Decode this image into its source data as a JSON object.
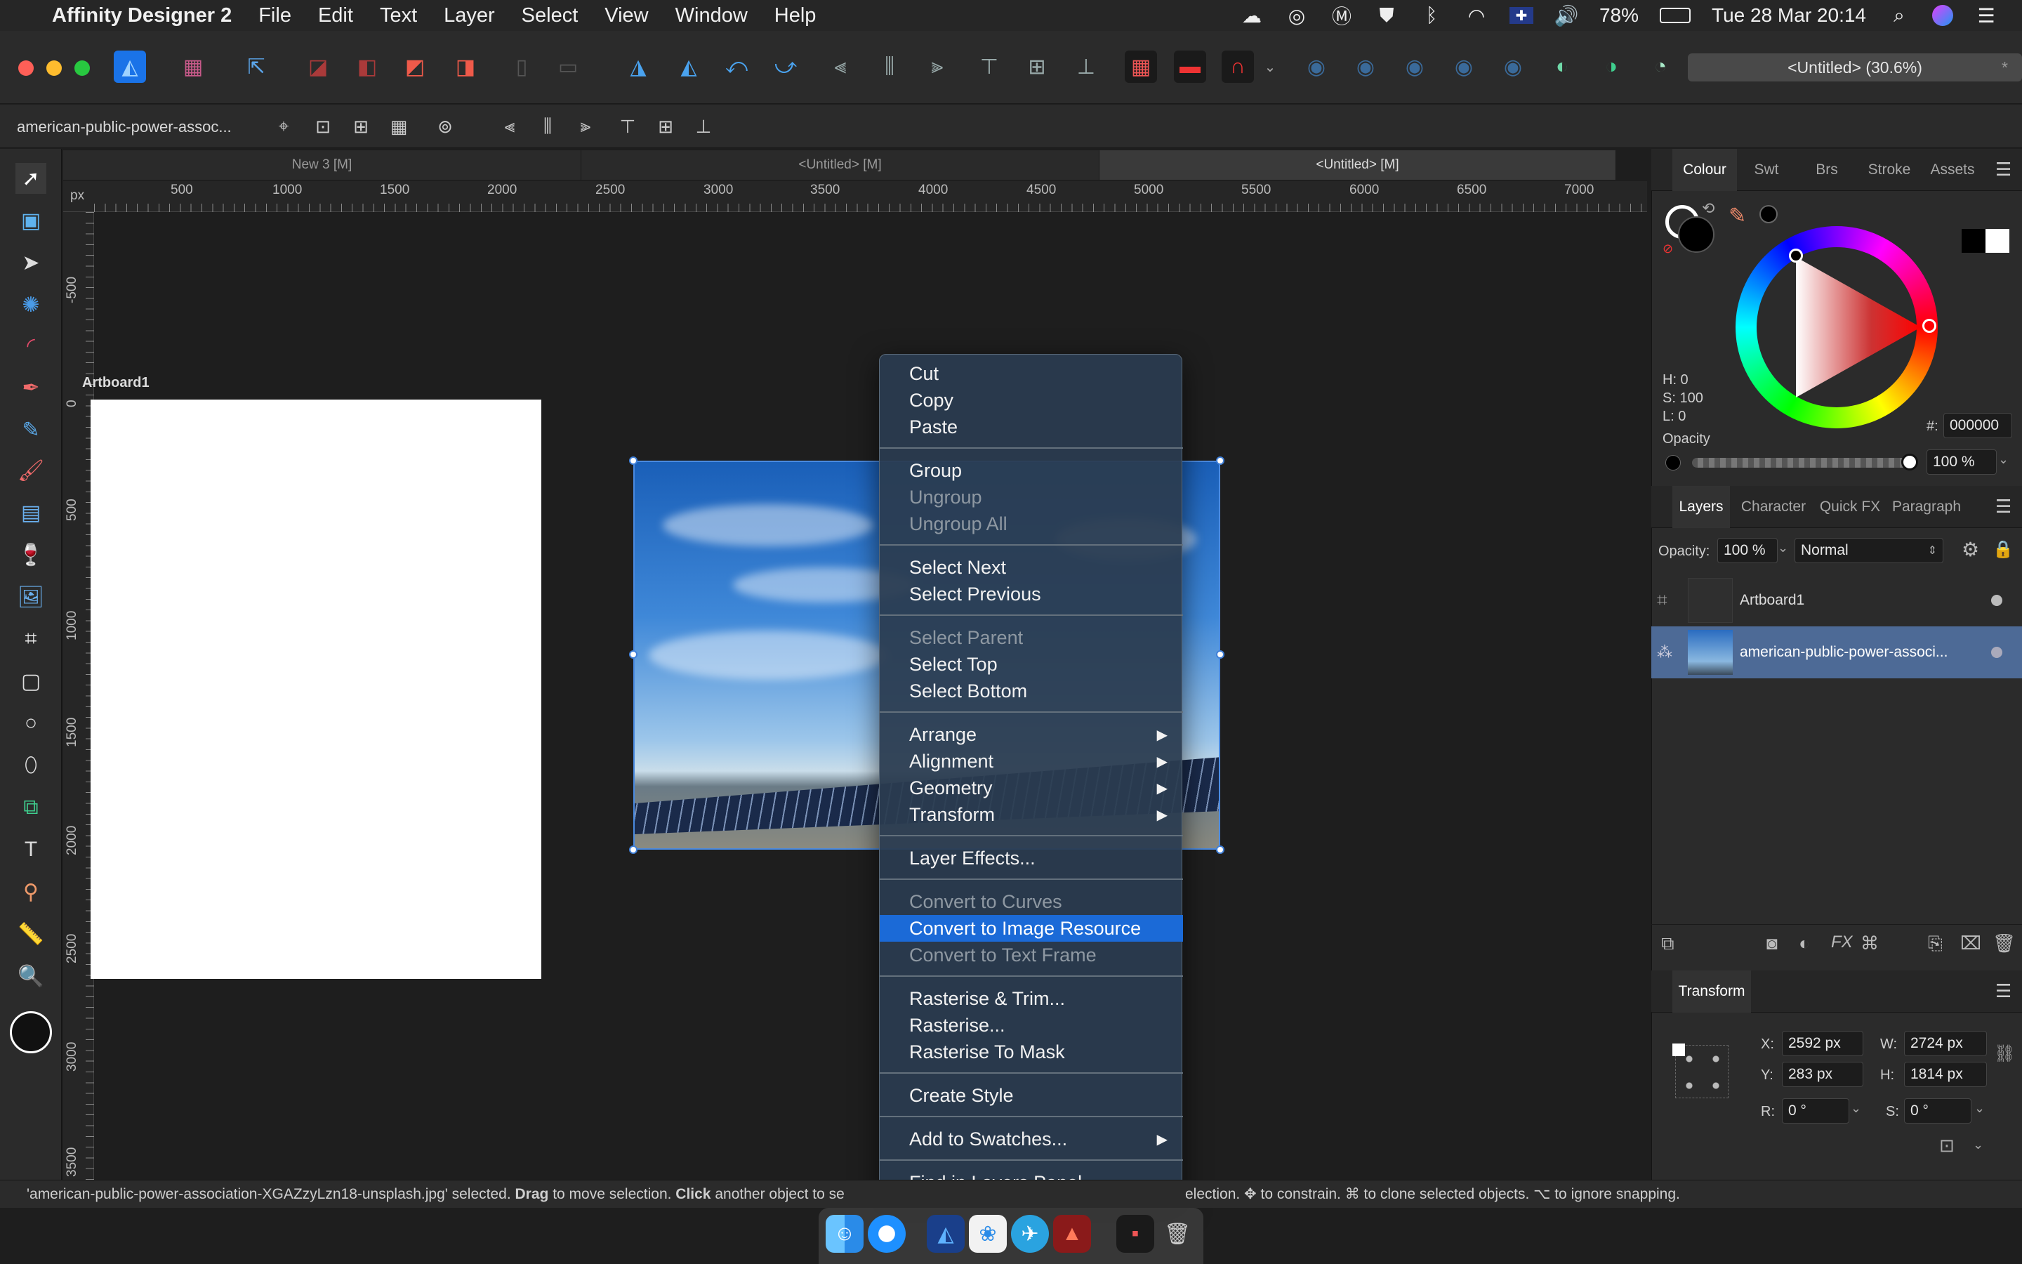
{
  "menubar": {
    "app": "Affinity Designer 2",
    "items": [
      "File",
      "Edit",
      "Text",
      "Layer",
      "Select",
      "View",
      "Window",
      "Help"
    ],
    "battery": "78%",
    "clock": "Tue 28 Mar  20:14"
  },
  "toolbar": {
    "document_title": "<Untitled> (30.6%)"
  },
  "context": {
    "selection_label": "american-public-power-assoc..."
  },
  "doc_tabs": [
    "New 3 [M]",
    "<Untitled> [M]",
    "<Untitled> [M]"
  ],
  "ruler": {
    "unit": "px",
    "h_ticks": [
      "500",
      "1000",
      "1500",
      "2000",
      "2500",
      "3000",
      "3500",
      "4000",
      "4500",
      "5000",
      "5500",
      "6000",
      "6500",
      "7000"
    ],
    "v_ticks": [
      "-500",
      "0",
      "500",
      "1000",
      "1500",
      "2000",
      "2500",
      "3000",
      "3500"
    ]
  },
  "canvas": {
    "artboard_label": "Artboard1"
  },
  "colour_panel": {
    "tabs": [
      "Colour",
      "Swt",
      "Brs",
      "Stroke",
      "Assets"
    ],
    "h": "H: 0",
    "s": "S: 100",
    "l": "L: 0",
    "hex_label": "#:",
    "hex": "000000",
    "opacity_label": "Opacity",
    "opacity": "100 %"
  },
  "layers_panel": {
    "tabs": [
      "Layers",
      "Character",
      "Quick FX",
      "Paragraph"
    ],
    "opacity_label": "Opacity:",
    "opacity": "100 %",
    "blend": "Normal",
    "layers": [
      "Artboard1",
      "american-public-power-associ..."
    ]
  },
  "transform_panel": {
    "title": "Transform",
    "x_label": "X:",
    "x": "2592 px",
    "y_label": "Y:",
    "y": "283 px",
    "w_label": "W:",
    "w": "2724 px",
    "h_label": "H:",
    "h": "1814 px",
    "r_label": "R:",
    "r": "0 °",
    "s_label": "S:",
    "s": "0 °"
  },
  "context_menu": {
    "items": [
      "Cut",
      "Copy",
      "Paste",
      "Group",
      "Ungroup",
      "Ungroup All",
      "Select Next",
      "Select Previous",
      "Select Parent",
      "Select Top",
      "Select Bottom",
      "Arrange",
      "Alignment",
      "Geometry",
      "Transform",
      "Layer Effects...",
      "Convert to Curves",
      "Convert to Image Resource",
      "Convert to Text Frame",
      "Rasterise & Trim...",
      "Rasterise...",
      "Rasterise To Mask",
      "Create Style",
      "Add to Swatches...",
      "Find in Layers Panel"
    ]
  },
  "statusbar": {
    "p1": "'american-public-power-association-XGAZzyLzn18-unsplash.jpg' selected. ",
    "b1": "Drag",
    "p2": " to move selection. ",
    "b2": "Click",
    "p3": " another object to se",
    "p4": "election. ✥ to constrain. ⌘ to clone selected objects. ⌥ to ignore snapping."
  }
}
